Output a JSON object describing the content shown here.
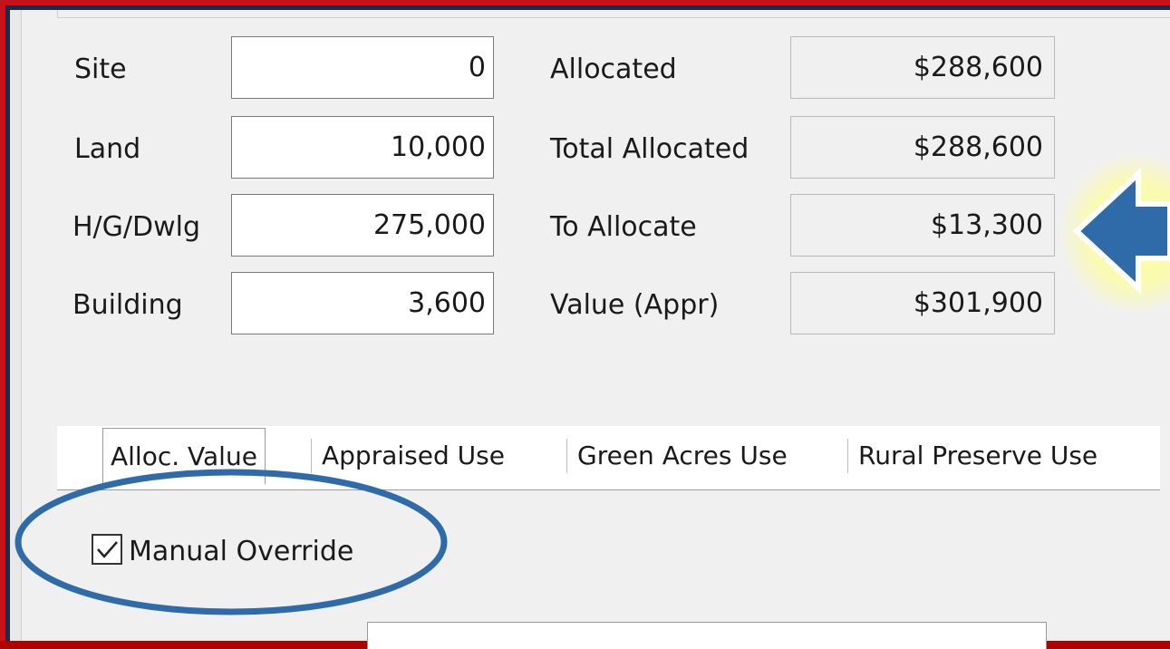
{
  "fields": [
    {
      "label": "Site",
      "value": "0"
    },
    {
      "label": "Land",
      "value": "10,000"
    },
    {
      "label": "H/G/Dwlg",
      "value": "275,000"
    },
    {
      "label": "Building",
      "value": "3,600"
    }
  ],
  "summary": [
    {
      "label": "Allocated",
      "value": "$288,600"
    },
    {
      "label": "Total Allocated",
      "value": "$288,600"
    },
    {
      "label": "To Allocate",
      "value": "$13,300"
    },
    {
      "label": "Value (Appr)",
      "value": "$301,900"
    }
  ],
  "tabs": [
    "Alloc. Value",
    "Appraised Use",
    "Green Acres Use",
    "Rural Preserve Use"
  ],
  "active_tab": "Alloc. Value",
  "manual_override": {
    "label": "Manual Override",
    "checked": true
  },
  "colors": {
    "frame": "#c8121a",
    "highlight_arrow": "#2f6aa9",
    "highlight_glow": "#ffff99",
    "highlight_ellipse": "#2f6aa9"
  },
  "icons": {
    "arrow": "left-arrow-icon",
    "check": "checkmark-icon"
  }
}
